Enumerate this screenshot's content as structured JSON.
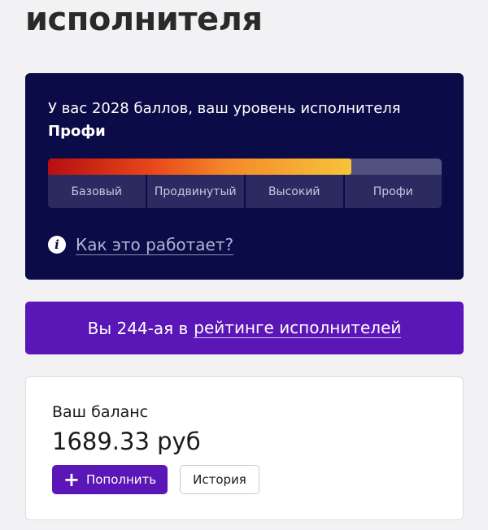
{
  "header": {
    "title": "исполнителя"
  },
  "level_card": {
    "intro": "У вас 2028 баллов, ваш уровень исполнителя",
    "level_name": "Профи",
    "progress_fraction": 0.77,
    "levels": [
      "Базовый",
      "Продвинутый",
      "Высокий",
      "Профи"
    ],
    "info_icon_glyph": "i",
    "how_it_works_link": "Как это работает?",
    "colors": {
      "background": "#0b0b47",
      "gradient_start": "#b50f0f",
      "gradient_end": "#f6c43a"
    }
  },
  "rating": {
    "prefix": "Вы 244-ая в",
    "link": "рейтинге исполнителей",
    "color": "#5a16b6"
  },
  "balance": {
    "label": "Ваш баланс",
    "value": "1689.33 руб",
    "topup_icon": "plus-icon",
    "topup_glyph": "+",
    "topup_label": "Пополнить",
    "history_label": "История"
  }
}
